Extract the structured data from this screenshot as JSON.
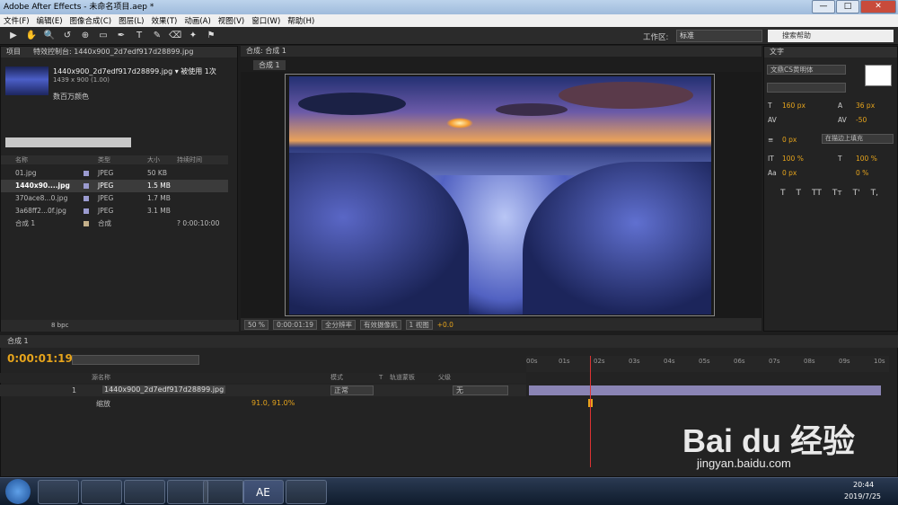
{
  "window": {
    "title": "Adobe After Effects - 未命名项目.aep *",
    "min": "—",
    "max": "□",
    "close": "✕"
  },
  "menu": [
    "文件(F)",
    "编辑(E)",
    "图像合成(C)",
    "图层(L)",
    "效果(T)",
    "动画(A)",
    "视图(V)",
    "窗口(W)",
    "帮助(H)"
  ],
  "toolbar": {
    "workspace_label": "工作区:",
    "workspace_value": "标准",
    "help_search": "搜索帮助",
    "tools": [
      "▶",
      "✋",
      "🔍",
      "↺",
      "⊕",
      "▭",
      "✒",
      "T",
      "✎",
      "⌫",
      "✦",
      "⚑"
    ]
  },
  "project": {
    "tab_project": "项目",
    "tab_effects": "特效控制台: 1440x900_2d7edf917d28899.jpg",
    "selected_name": "1440x900_2d7edf917d28899.jpg ▾ 被使用 1次",
    "selected_dims": "1439 x 900 (1.00)",
    "selected_color": "数百万颜色",
    "headers": [
      "名称",
      "类型",
      "大小",
      "持续时间"
    ],
    "items": [
      {
        "name": "01.jpg",
        "type": "JPEG",
        "size": "50 KB",
        "duration": "",
        "color": "#9b9bd0"
      },
      {
        "name": "1440x90....jpg",
        "type": "JPEG",
        "size": "1.5 MB",
        "duration": "",
        "color": "#9b9bd0"
      },
      {
        "name": "370ace8...0.jpg",
        "type": "JPEG",
        "size": "1.7 MB",
        "duration": "",
        "color": "#9b9bd0"
      },
      {
        "name": "3a68ff2...0f.jpg",
        "type": "JPEG",
        "size": "3.1 MB",
        "duration": "",
        "color": "#9b9bd0"
      },
      {
        "name": "合成 1",
        "type": "合成",
        "size": "",
        "duration": "? 0:00:10:00",
        "color": "#c4b08a"
      }
    ],
    "bpc": "8 bpc"
  },
  "viewer": {
    "tab": "合成: 合成 1",
    "subtab": "合成 1",
    "zoom": "50 %",
    "time": "0:00:01:19",
    "resolution": "全分辨率",
    "camera": "有效摄像机",
    "views": "1 视图",
    "offset": "+0.0"
  },
  "text_panel": {
    "tab": "文字",
    "font": "文鼎CS黄明体",
    "size": "160 px",
    "leading": "36 px",
    "tracking": "-50",
    "stroke": "0 px",
    "stroke_mode": "在描边上填充",
    "vscale": "100 %",
    "hscale": "100 %",
    "baseline": "0 px",
    "tsume": "0 %",
    "styles": [
      "T",
      "T",
      "TT",
      "Tт",
      "T'",
      "T,"
    ]
  },
  "timeline": {
    "tab": "合成 1",
    "timecode": "0:00:01:19",
    "cols": {
      "source": "源名称",
      "mode": "模式",
      "t": "T",
      "trkmat": "轨道蒙板",
      "parent": "父级"
    },
    "layer": {
      "num": "1",
      "name": "1440x900_2d7edf917d28899.jpg",
      "mode": "正常",
      "parent": "无"
    },
    "property": {
      "name": "缩放",
      "value": "91.0, 91.0%"
    },
    "ruler": [
      "00s",
      "01s",
      "02s",
      "03s",
      "04s",
      "05s",
      "06s",
      "07s",
      "08s",
      "09s",
      "10s"
    ]
  },
  "taskbar": {
    "time": "20:44",
    "date": "2019/7/25",
    "ae": "AE"
  },
  "watermark": {
    "logo": "Bai du 经验",
    "url": "jingyan.baidu.com"
  }
}
